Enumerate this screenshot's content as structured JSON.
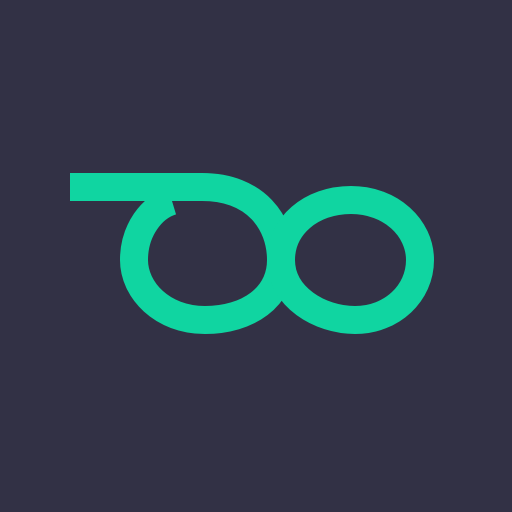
{
  "background_color": "#323145",
  "logo": {
    "icon": "infinity-loop-logo-icon",
    "color": "#10d5a1"
  }
}
